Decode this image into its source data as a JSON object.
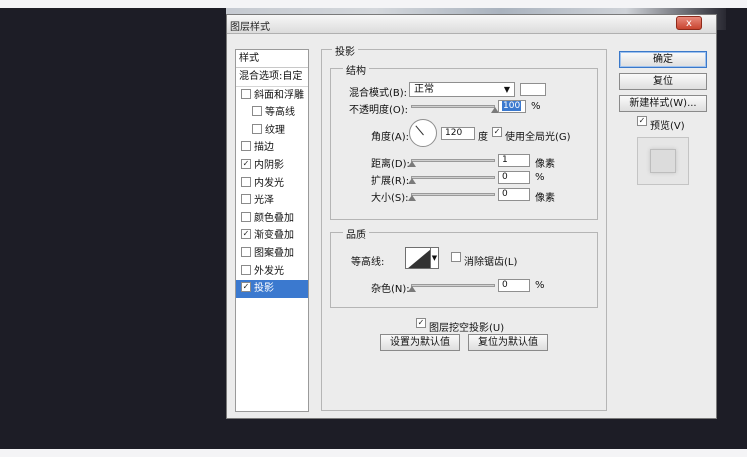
{
  "dialog": {
    "title": "图层样式",
    "close_label": "x"
  },
  "style_list": {
    "header": "样式",
    "blend_options": "混合选项:自定",
    "items": [
      {
        "label": "斜面和浮雕",
        "checked": false,
        "sub": false
      },
      {
        "label": "等高线",
        "checked": false,
        "sub": true
      },
      {
        "label": "纹理",
        "checked": false,
        "sub": true
      },
      {
        "label": "描边",
        "checked": false,
        "sub": false
      },
      {
        "label": "内阴影",
        "checked": true,
        "sub": false
      },
      {
        "label": "内发光",
        "checked": false,
        "sub": false
      },
      {
        "label": "光泽",
        "checked": false,
        "sub": false
      },
      {
        "label": "颜色叠加",
        "checked": false,
        "sub": false
      },
      {
        "label": "渐变叠加",
        "checked": true,
        "sub": false
      },
      {
        "label": "图案叠加",
        "checked": false,
        "sub": false
      },
      {
        "label": "外发光",
        "checked": false,
        "sub": false
      },
      {
        "label": "投影",
        "checked": true,
        "sub": false,
        "selected": true
      }
    ]
  },
  "panel": {
    "section_title": "投影",
    "structure": {
      "title": "结构",
      "blend_mode_label": "混合模式(B):",
      "blend_mode_value": "正常",
      "opacity_label": "不透明度(O):",
      "opacity_value": "100",
      "opacity_unit": "%",
      "angle_label": "角度(A):",
      "angle_value": "120",
      "angle_unit": "度",
      "global_light_label": "使用全局光(G)",
      "global_light_checked": true,
      "distance_label": "距离(D):",
      "distance_value": "1",
      "distance_unit": "像素",
      "spread_label": "扩展(R):",
      "spread_value": "0",
      "spread_unit": "%",
      "size_label": "大小(S):",
      "size_value": "0",
      "size_unit": "像素"
    },
    "quality": {
      "title": "品质",
      "contour_label": "等高线:",
      "antialias_label": "消除锯齿(L)",
      "antialias_checked": false,
      "noise_label": "杂色(N):",
      "noise_value": "0",
      "noise_unit": "%"
    },
    "knockout_label": "图层挖空投影(U)",
    "knockout_checked": true,
    "make_default_label": "设置为默认值",
    "reset_default_label": "复位为默认值"
  },
  "actions": {
    "ok_label": "确定",
    "reset_label": "复位",
    "new_style_label": "新建样式(W)...",
    "preview_label": "预览(V)",
    "preview_checked": true
  },
  "colors": {
    "background": "#1d1d26",
    "dialog": "#ececec",
    "selection": "#3b79cf"
  }
}
